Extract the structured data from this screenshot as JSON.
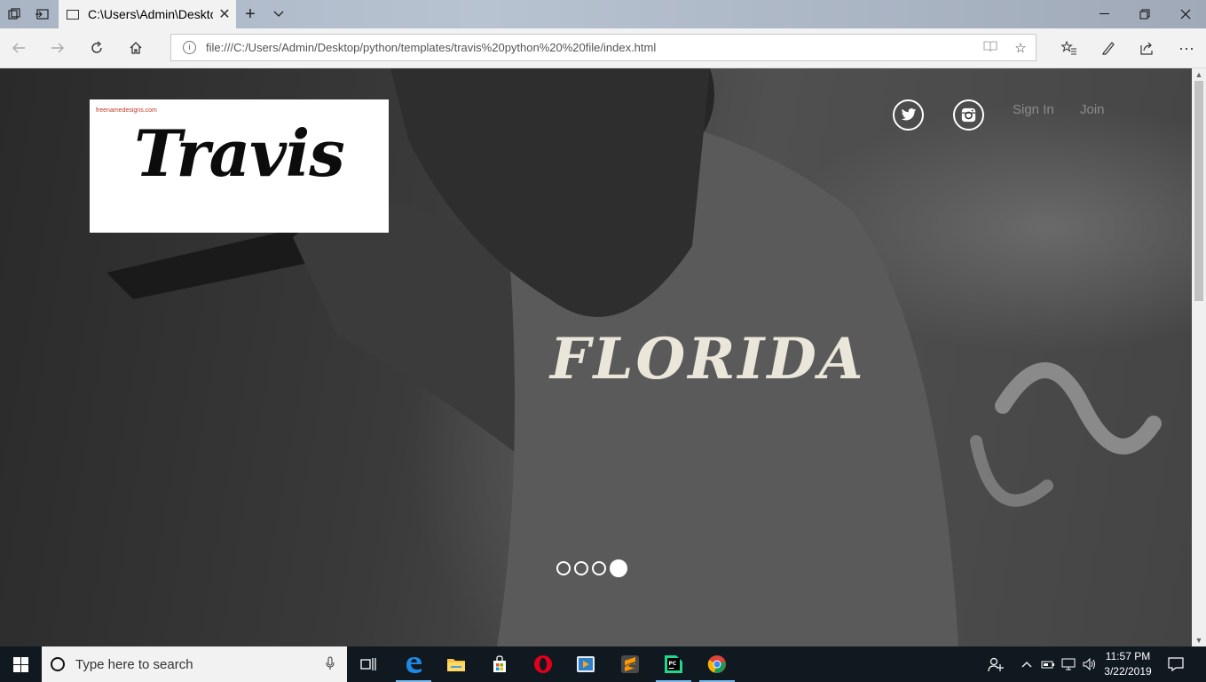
{
  "browser": {
    "tab_title": "C:\\Users\\Admin\\Deskto",
    "url": "file:///C:/Users/Admin/Desktop/python/templates/travis%20python%20%20file/index.html"
  },
  "site": {
    "logo_small_text": "freenamedesigns.com",
    "logo_text": "Travis",
    "sign_in": "Sign In",
    "join": "Join",
    "headline": "FLORIDA",
    "slider": {
      "count": 4,
      "active_index": 3
    }
  },
  "taskbar": {
    "search_placeholder": "Type here to search",
    "time": "11:57 PM",
    "date": "3/22/2019",
    "pinned_apps": [
      "edge-icon",
      "file-explorer-icon",
      "store-icon",
      "opera-icon",
      "media-player-icon",
      "sublime-text-icon",
      "pycharm-icon",
      "chrome-icon"
    ]
  },
  "colors": {
    "headline": "#ebe6da",
    "accent": "#76b9ed",
    "taskbar": "#101820"
  }
}
